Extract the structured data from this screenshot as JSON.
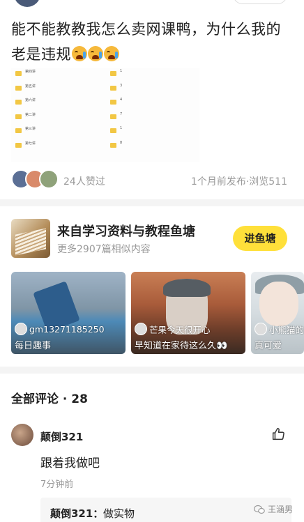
{
  "post": {
    "text": "能不能教教我怎么卖网课鸭，为什么我的老是违规",
    "emoji_count": 3
  },
  "file_list": {
    "left_names": [
      "第四讲",
      "第五讲",
      "第六讲",
      "第二讲",
      "第三讲",
      "第七讲"
    ],
    "right_names": [
      "1",
      "3",
      "4",
      "7",
      "1",
      "8"
    ]
  },
  "likes": {
    "count_text": "24人赞过",
    "meta_text": "1个月前发布·浏览511"
  },
  "pond": {
    "title": "来自学习资料与教程鱼塘",
    "subtitle": "更多2907篇相似内容",
    "join_label": "进鱼塘"
  },
  "videos": [
    {
      "user": "gm13271185250",
      "title": "每日趣事"
    },
    {
      "user": "芒果今天很开心",
      "title": "早知道在家待这么久👀"
    },
    {
      "user": "小熊猫的",
      "title": "真可爱"
    }
  ],
  "comments": {
    "header": "全部评论 · 28",
    "items": [
      {
        "name": "颠倒321",
        "text": "跟着我做吧",
        "time": "7分钟前",
        "reply_name": "颠倒321：",
        "reply_text": "做实物"
      }
    ]
  },
  "watermark": {
    "text": "王涵男"
  },
  "colors": {
    "accent": "#ffe03a",
    "secondary_text": "#999999"
  }
}
